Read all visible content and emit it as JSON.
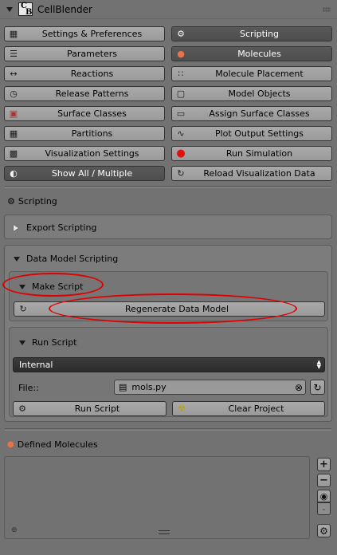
{
  "header": {
    "title": "CellBlender",
    "logo_top": "C",
    "logo_bottom": "B"
  },
  "buttons": {
    "settings": "Settings & Preferences",
    "scripting": "Scripting",
    "parameters": "Parameters",
    "molecules": "Molecules",
    "reactions": "Reactions",
    "molecule_placement": "Molecule Placement",
    "release_patterns": "Release Patterns",
    "model_objects": "Model Objects",
    "surface_classes": "Surface Classes",
    "assign_surface_classes": "Assign Surface Classes",
    "partitions": "Partitions",
    "plot_output_settings": "Plot Output Settings",
    "visualization_settings": "Visualization Settings",
    "run_simulation": "Run Simulation",
    "show_all": "Show All / Multiple",
    "reload_visualization": "Reload Visualization Data"
  },
  "scripting_section": {
    "title": "Scripting",
    "export_scripting": "Export Scripting",
    "data_model_scripting": "Data Model Scripting",
    "make_script": "Make Script",
    "regenerate_data_model": "Regenerate Data Model",
    "run_script_title": "Run Script",
    "mode_selected": "Internal",
    "file_label": "File::",
    "file_value": "mols.py",
    "run_script_button": "Run Script",
    "clear_project_button": "Clear Project"
  },
  "defined_molecules": {
    "title": "Defined Molecules"
  },
  "colors": {
    "annotation": "#e00000",
    "active_button": "#545454",
    "panel": "#727272"
  }
}
